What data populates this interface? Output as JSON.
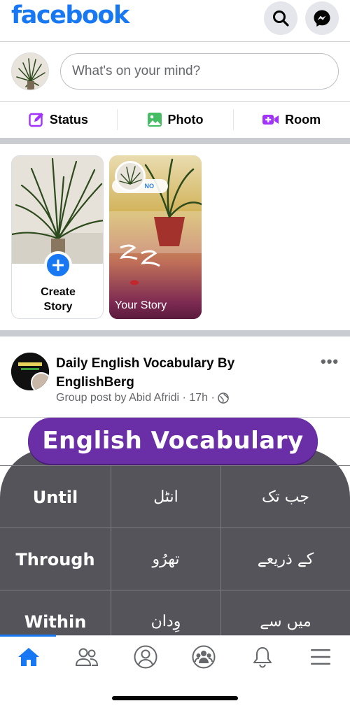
{
  "header": {
    "logo": "facebook",
    "icons": [
      "search-icon",
      "messenger-icon"
    ]
  },
  "composer": {
    "placeholder": "What's on your mind?"
  },
  "actions": [
    {
      "label": "Status",
      "icon": "edit-icon",
      "color": "#a233ff"
    },
    {
      "label": "Photo",
      "icon": "photo-icon",
      "color": "#45bd62"
    },
    {
      "label": "Room",
      "icon": "video-plus-icon",
      "color": "#a233ff"
    }
  ],
  "stories": {
    "create_label_line1": "Create",
    "create_label_line2": "Story",
    "yours_label": "Your Story",
    "yours_bubble": "NO"
  },
  "post": {
    "title": "Daily English Vocabulary By EnglishBerg",
    "meta": "Group post by Abid Afridi · 17h ·",
    "more": "•••",
    "image": {
      "banner": "English Vocabulary",
      "rows": [
        {
          "en": "Until",
          "mid": "انٹل",
          "ur": "جب تک"
        },
        {
          "en": "Through",
          "mid": "تھرُو",
          "ur": "کے ذریعے"
        },
        {
          "en": "Within",
          "mid": "وِدان",
          "ur": "میں سے"
        }
      ]
    }
  },
  "bottom_nav": {
    "items": [
      "home-icon",
      "friends-icon",
      "profile-icon",
      "groups-icon",
      "notifications-icon",
      "menu-icon"
    ],
    "active": "home-icon"
  },
  "colors": {
    "brand": "#1877f2",
    "vocab_banner": "#6a2ea6",
    "vocab_card": "#55545a"
  }
}
